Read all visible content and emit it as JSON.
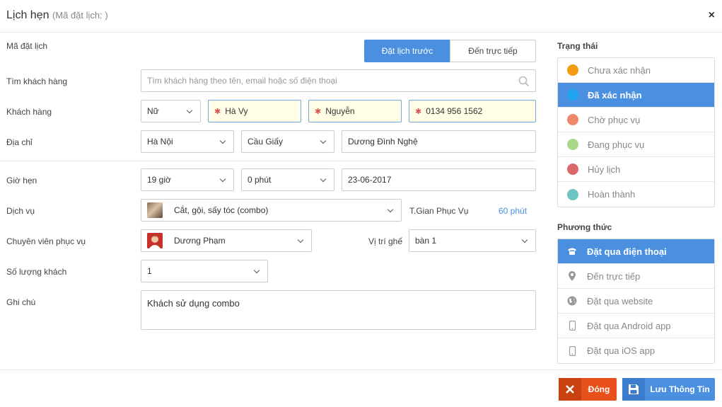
{
  "header": {
    "title": "Lịch hẹn",
    "subtitle": "(Mã đặt lịch: )",
    "close": "×"
  },
  "labels": {
    "code": "Mã đặt lịch",
    "search": "Tìm khách hàng",
    "customer": "Khách hàng",
    "address": "Địa chỉ",
    "time": "Giờ hẹn",
    "service": "Dịch vụ",
    "staff": "Chuyên viên phục vụ",
    "guests": "Số lượng khách",
    "note": "Ghi chú",
    "duration": "T.Gian Phục Vụ",
    "seat": "Vị trí ghế"
  },
  "booking_type": {
    "options": [
      "Đặt lịch trước",
      "Đến trực tiếp"
    ],
    "selected": "Đặt lịch trước"
  },
  "search": {
    "placeholder": "Tìm khách hàng theo tên, email hoặc số điện thoại",
    "value": ""
  },
  "customer": {
    "gender": "Nữ",
    "first_name": "Hà Vy",
    "last_name": "Nguyễn",
    "phone": "0134 956 1562"
  },
  "address": {
    "city": "Hà Nội",
    "district": "Cầu Giấy",
    "street": "Dương Đình Nghệ"
  },
  "appointment": {
    "hour": "19 giờ",
    "minute": "0 phút",
    "date": "23-06-2017"
  },
  "service": {
    "value": "Cắt, gội, sấy tóc (combo)",
    "duration": "60 phút"
  },
  "staff": {
    "value": "Dương Phạm",
    "seat": "bàn 1"
  },
  "guests": {
    "value": "1"
  },
  "note": {
    "value": "Khách sử dụng combo"
  },
  "status": {
    "title": "Trạng thái",
    "selected": "Đã xác nhận",
    "items": [
      {
        "label": "Chưa xác nhận",
        "color": "#f39c12"
      },
      {
        "label": "Đã xác nhận",
        "color": "#1fa3f0"
      },
      {
        "label": "Chờ phục vụ",
        "color": "#f0876a"
      },
      {
        "label": "Đang phục vụ",
        "color": "#a8d88a"
      },
      {
        "label": "Hủy lịch",
        "color": "#d9686a"
      },
      {
        "label": "Hoàn thành",
        "color": "#6cc5c0"
      }
    ]
  },
  "method": {
    "title": "Phương thức",
    "selected": "Đặt qua điện thoại",
    "items": [
      {
        "label": "Đặt qua điện thoại",
        "icon": "phone-icon"
      },
      {
        "label": "Đến trực tiếp",
        "icon": "location-pin-icon"
      },
      {
        "label": "Đặt qua website",
        "icon": "globe-icon"
      },
      {
        "label": "Đặt qua Android app",
        "icon": "mobile-icon"
      },
      {
        "label": "Đặt qua iOS app",
        "icon": "mobile-icon"
      }
    ]
  },
  "footer": {
    "close_label": "Đóng",
    "save_label": "Lưu Thông Tin"
  }
}
